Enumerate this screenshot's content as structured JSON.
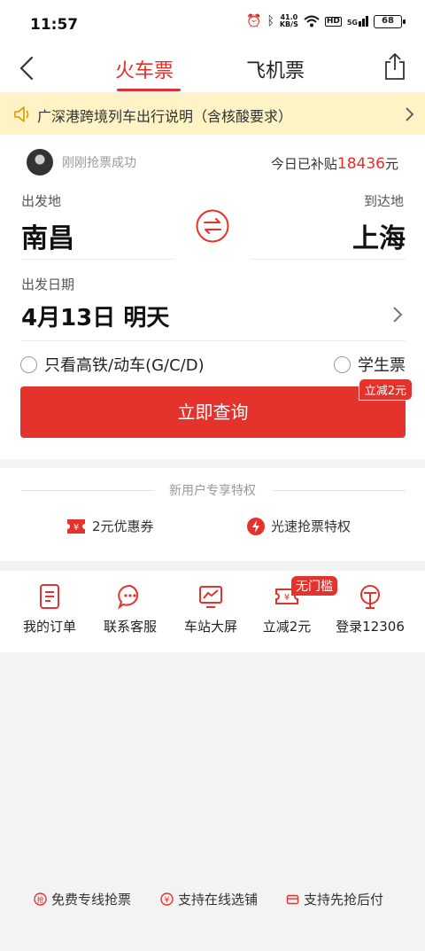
{
  "status_bar": {
    "time": "11:57",
    "net_speed_value": "41.0",
    "net_speed_unit": "KB/S",
    "hd": "HD",
    "signal": "5G",
    "battery": "68"
  },
  "nav": {
    "tabs": [
      {
        "label": "火车票",
        "active": true
      },
      {
        "label": "飞机票",
        "active": false
      }
    ]
  },
  "notice": {
    "text": "广深港跨境列车出行说明（含核酸要求）"
  },
  "ticket_form": {
    "grab_status": "刚刚抢票成功",
    "subsidy_prefix": "今日已补贴",
    "subsidy_amount": "18436",
    "subsidy_unit": "元",
    "from_label": "出发地",
    "to_label": "到达地",
    "from_city": "南昌",
    "to_city": "上海",
    "date_label": "出发日期",
    "date_value": "4月13日 明天",
    "option_high_speed": "只看高铁/动车(G/C/D)",
    "option_student": "学生票",
    "discount_tag": "立减2元",
    "search_button": "立即查询"
  },
  "privileges": {
    "title": "新用户专享特权",
    "items": [
      {
        "label": "2元优惠券",
        "icon": "coupon-icon"
      },
      {
        "label": "光速抢票特权",
        "icon": "lightning-icon"
      }
    ]
  },
  "quick_links": {
    "items": [
      {
        "label": "我的订单",
        "icon": "order-icon"
      },
      {
        "label": "联系客服",
        "icon": "chat-icon"
      },
      {
        "label": "车站大屏",
        "icon": "screen-icon"
      },
      {
        "label": "立减2元",
        "icon": "ticket-coupon-icon"
      },
      {
        "label": "登录12306",
        "icon": "railway-logo-icon"
      }
    ],
    "badge": "无门槛"
  },
  "footer": {
    "items": [
      {
        "label": "免费专线抢票",
        "icon": "grab-icon"
      },
      {
        "label": "支持在线选铺",
        "icon": "yuan-icon"
      },
      {
        "label": "支持先抢后付",
        "icon": "wallet-icon"
      }
    ]
  },
  "colors": {
    "accent": "#e4322c",
    "notice_bg": "#fdf3c4",
    "page_bg": "#f3f3f3"
  }
}
